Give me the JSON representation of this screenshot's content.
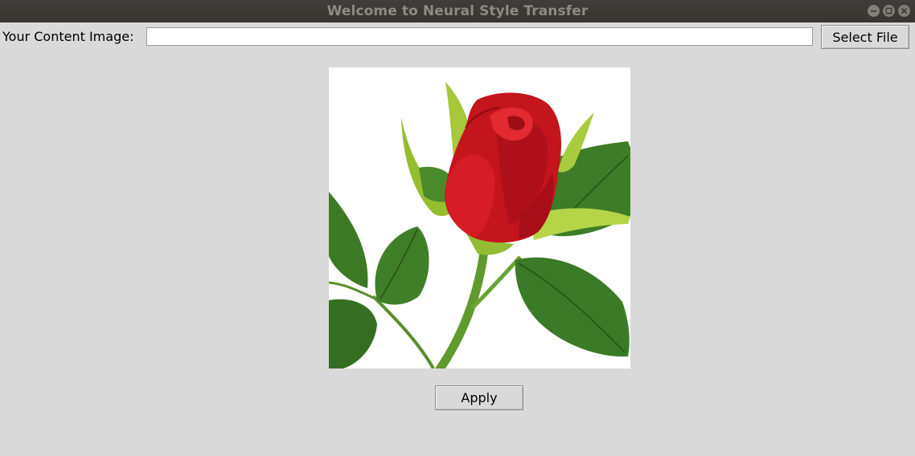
{
  "window": {
    "title": "Welcome to Neural Style Transfer",
    "controls": [
      "minimize-icon",
      "maximize-icon",
      "close-icon"
    ]
  },
  "content_row": {
    "label": "Your Content Image:",
    "path_value": "",
    "select_button": "Select File"
  },
  "preview": {
    "subject": "red-rose-image"
  },
  "actions": {
    "apply_label": "Apply"
  },
  "colors": {
    "background": "#d9d9d9",
    "titlebar": "#3a3935",
    "title_text": "#8c8b86"
  }
}
